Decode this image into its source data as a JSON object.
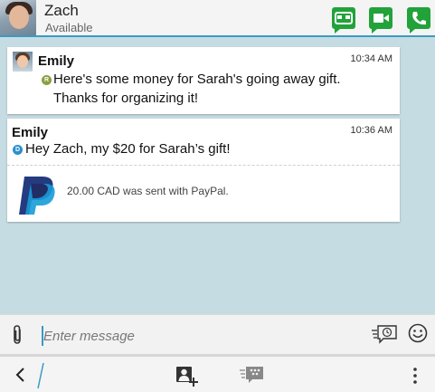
{
  "header": {
    "contact_name": "Zach",
    "contact_status": "Available",
    "icons": [
      "bbm-video-mask-icon",
      "video-call-icon",
      "phone-call-icon"
    ],
    "accent_color": "#22a23a"
  },
  "messages": [
    {
      "sender": "Emily",
      "time": "10:34 AM",
      "line1": "Here's some money for Sarah's going away gift.",
      "line2": "Thanks for organizing it!"
    },
    {
      "sender": "Emily",
      "time": "10:36 AM",
      "text": "Hey Zach, my $20 for Sarah’s gift!",
      "payment_text": "20.00 CAD was sent with PayPal."
    }
  ],
  "composer": {
    "placeholder": "Enter message",
    "icons": [
      "paperclip-icon",
      "timed-message-icon",
      "smiley-icon"
    ]
  },
  "action_bar": {
    "icons": [
      "back-icon",
      "add-participant-icon",
      "bbm-chat-icon",
      "more-options-icon"
    ]
  },
  "colors": {
    "header_accent": "#3a9bc3",
    "paypal_dark": "#253b80",
    "paypal_light": "#179bd7",
    "background": "#c6dce3"
  }
}
